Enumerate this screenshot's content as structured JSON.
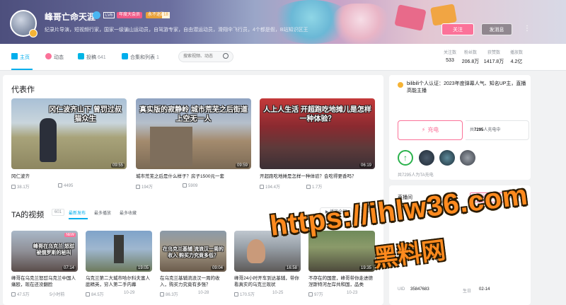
{
  "user": {
    "name": "峰哥亡命天涯",
    "lv_tag": "LV6",
    "vip_tag": "年度大会员",
    "fans_tag": "永不迷路",
    "fans_lv": "18",
    "sign": "纪录片导演，短视频行家，国家一级骗山运动员，自驾游专家，自由潜运动员，滑翔伞飞行员，4个都是假，B站知识区王",
    "follow_label": "关注",
    "message_label": "发消息",
    "more_glyph": "⋮"
  },
  "nav": {
    "items": [
      {
        "label": "主页",
        "count": ""
      },
      {
        "label": "动态",
        "count": ""
      },
      {
        "label": "投稿",
        "count": "641"
      },
      {
        "label": "合集和列表",
        "count": "1"
      }
    ],
    "search_placeholder": "搜索视频、动态"
  },
  "stats": [
    {
      "label": "关注数",
      "value": "533"
    },
    {
      "label": "粉丝数",
      "value": "206.8万"
    },
    {
      "label": "获赞数",
      "value": "1417.8万"
    },
    {
      "label": "播放数",
      "value": "4.2亿"
    }
  ],
  "representative": {
    "title": "代表作",
    "videos": [
      {
        "cover_text": "冈仁波齐山下 曾罚过叔猫众生",
        "duration": "09:55",
        "title": "冈仁波齐",
        "plays": "38.1万",
        "danmaku": "4495"
      },
      {
        "cover_text": "真实版的寂静岭 城市荒芜之后街道上空无一人",
        "duration": "09:59",
        "title": "城市荒芜之后是什么样子？房子1500元一套",
        "plays": "194万",
        "danmaku": "5909"
      },
      {
        "cover_text": "人上人生活 开超跑吃地摊儿是怎样一种体验？",
        "duration": "06:19",
        "title": "开超跑吃地摊是怎样一种体验？会吃得更香吗？",
        "plays": "194.4万",
        "danmaku": "1.7万"
      }
    ]
  },
  "ta_videos": {
    "title": "TA的视频",
    "count": "601",
    "tabs": [
      "最新发布",
      "最多播放",
      "最多收藏"
    ],
    "play_all": "播放全部",
    "more": "更多",
    "videos": [
      {
        "cover_text": "峰哥在乌克兰 怒怼被俄罗斯的秘叫",
        "duration": "07:14",
        "is_new": true,
        "title": "峰哥在乌克兰怒怼乌克兰中国人痛殴，现在还没翻脸",
        "plays": "47.5万",
        "date": "5小时前"
      },
      {
        "cover_text": "",
        "duration": "19:05",
        "is_new": false,
        "title": "乌克兰第二大城市哈尔科夫富人庭精英，穷人第二手内幕",
        "plays": "84.5万",
        "date": "10-29"
      },
      {
        "cover_text": "在乌克兰基辅 流浪汉一周的收入 购买力究竟多低？",
        "duration": "09:04",
        "is_new": false,
        "title": "在乌克兰基辅流浪汉一周的收入，购买力究竟有多强？",
        "plays": "86.3万",
        "date": "10-28"
      },
      {
        "cover_text": "",
        "duration": "16:58",
        "is_new": false,
        "title": "峰哥24小时开车到达基辅，带你看真实的乌克兰现状",
        "plays": "170.5万",
        "date": "10-25"
      },
      {
        "cover_text": "",
        "duration": "19:35",
        "is_new": false,
        "title": "不存在的国度，峰哥带你走进德涅斯特河左岸共和国，品类",
        "plays": "97万",
        "date": "10-23"
      }
    ]
  },
  "side": {
    "cert_text": "bilibili个人认证：2023年度弹幕人气、知名UP主，直播高能主播",
    "charge_label": "充电",
    "charge_prefix": "共",
    "charge_num": "7295",
    "charge_suffix": "人充电中",
    "charge_count": "共7295人为TA充电",
    "live_title": "直播间",
    "live_follow": "关注直播间",
    "live_count": "206.8万",
    "uid_label": "UID",
    "uid_value": "35847683",
    "bday_label": "生日",
    "bday_value": "02-14"
  },
  "watermark": {
    "line1": "https://ihlw36.com",
    "line2": "黑料网"
  },
  "colors": {
    "accent": "#00aeec",
    "pink": "#fb7299"
  }
}
